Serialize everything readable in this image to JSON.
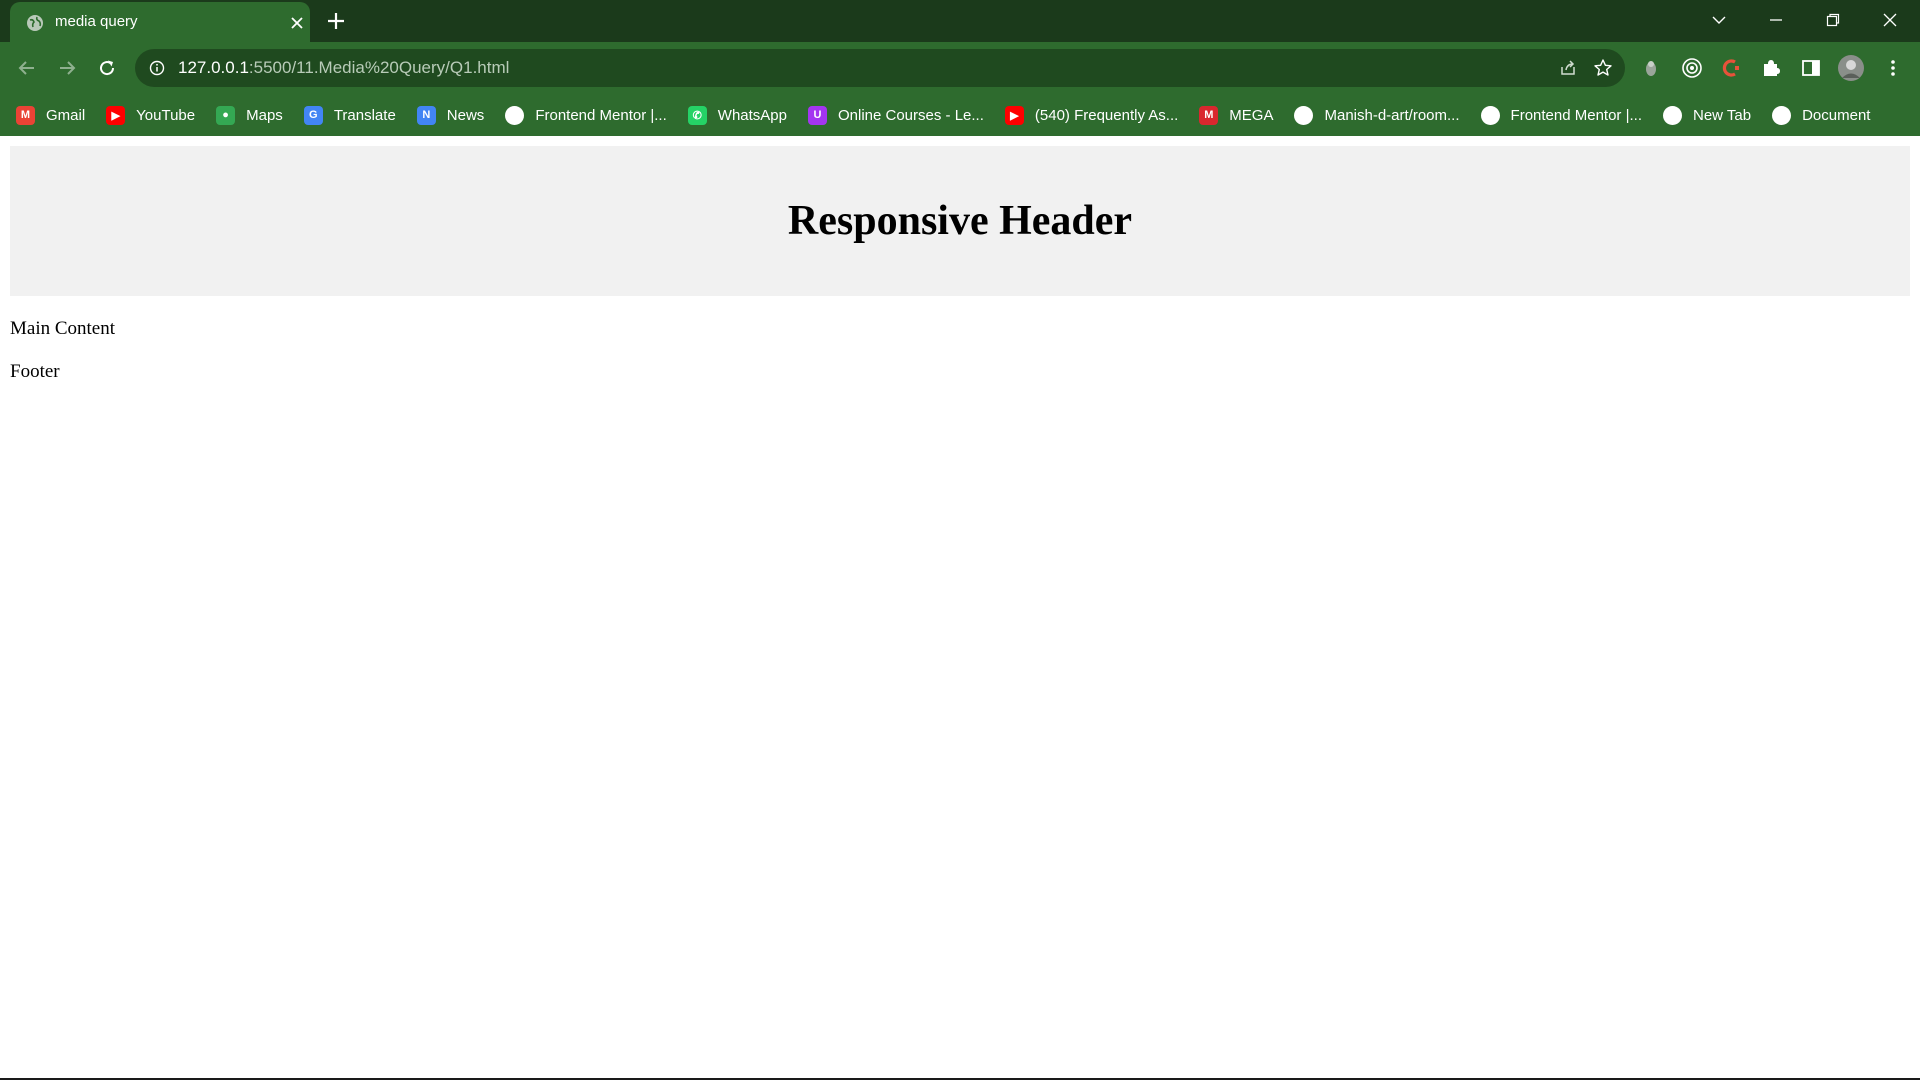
{
  "browser": {
    "tab": {
      "title": "media query"
    },
    "url": {
      "host": "127.0.0.1",
      "path": ":5500/11.Media%20Query/Q1.html"
    },
    "colors": {
      "frame": "#1b3a1b",
      "toolbar": "#2e6b2e",
      "omnibox": "#1f4a1f"
    }
  },
  "bookmarks": [
    {
      "label": "Gmail",
      "icon": "gmail-icon",
      "color": "#ea4335",
      "glyph": "M"
    },
    {
      "label": "YouTube",
      "icon": "youtube-icon",
      "color": "#ff0000",
      "glyph": "▶"
    },
    {
      "label": "Maps",
      "icon": "maps-icon",
      "color": "#34a853",
      "glyph": "●"
    },
    {
      "label": "Translate",
      "icon": "translate-icon",
      "color": "#4285f4",
      "glyph": "G"
    },
    {
      "label": "News",
      "icon": "news-icon",
      "color": "#4285f4",
      "glyph": "N"
    },
    {
      "label": "Frontend Mentor |...",
      "icon": "frontend-mentor-icon",
      "color": "#ffffff",
      "glyph": ""
    },
    {
      "label": "WhatsApp",
      "icon": "whatsapp-icon",
      "color": "#25d366",
      "glyph": "✆"
    },
    {
      "label": "Online Courses - Le...",
      "icon": "udemy-icon",
      "color": "#a435f0",
      "glyph": "U"
    },
    {
      "label": "(540) Frequently As...",
      "icon": "youtube-icon",
      "color": "#ff0000",
      "glyph": "▶"
    },
    {
      "label": "MEGA",
      "icon": "mega-icon",
      "color": "#d9272e",
      "glyph": "M"
    },
    {
      "label": "Manish-d-art/room...",
      "icon": "github-icon",
      "color": "#ffffff",
      "glyph": ""
    },
    {
      "label": "Frontend Mentor |...",
      "icon": "globe-icon",
      "color": "#ffffff",
      "glyph": ""
    },
    {
      "label": "New Tab",
      "icon": "globe-icon",
      "color": "#ffffff",
      "glyph": ""
    },
    {
      "label": "Document",
      "icon": "document-icon",
      "color": "#ffffff",
      "glyph": ""
    }
  ],
  "page": {
    "header_title": "Responsive Header",
    "main_text": "Main Content",
    "footer_text": "Footer",
    "header_bg": "#f1f1f1"
  }
}
